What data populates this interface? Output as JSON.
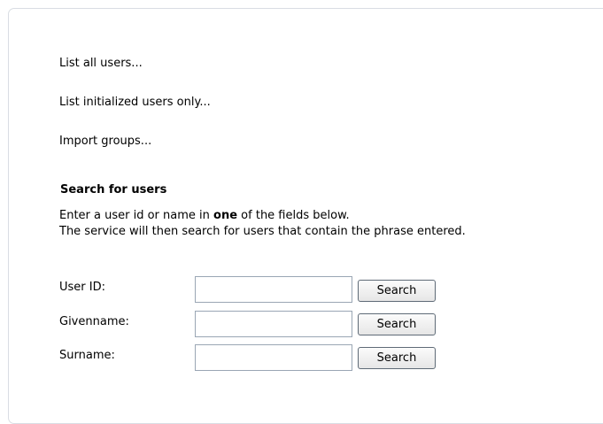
{
  "links": {
    "list_all": "List all users...",
    "list_initialized": "List initialized users only...",
    "import_groups": "Import groups..."
  },
  "search": {
    "title": "Search for users",
    "instruction_before": "Enter a user id or name in ",
    "instruction_emphasis": "one",
    "instruction_after": " of the fields below.",
    "instruction_line2": "The service will then search for users that contain the phrase entered.",
    "rows": [
      {
        "label": "User ID:",
        "value": "",
        "button": "Search"
      },
      {
        "label": "Givenname:",
        "value": "",
        "button": "Search"
      },
      {
        "label": "Surname:",
        "value": "",
        "button": "Search"
      }
    ]
  }
}
